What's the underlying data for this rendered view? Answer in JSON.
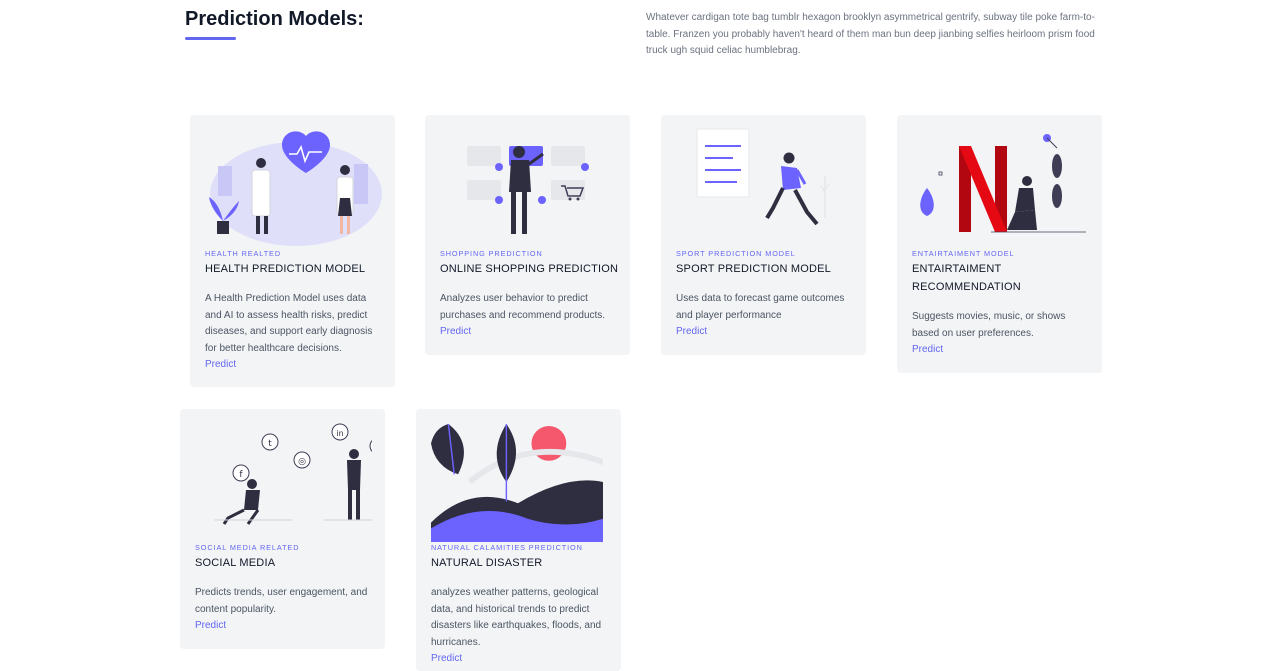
{
  "header": {
    "title": "Prediction Models:",
    "description": "Whatever cardigan tote bag tumblr hexagon brooklyn asymmetrical gentrify, subway tile poke farm-to-table. Franzen you probably haven't heard of them man bun deep jianbing selfies heirloom prism food truck ugh squid celiac humblebrag."
  },
  "cards": [
    {
      "category": "HEALTH REALTED",
      "name": "HEALTH PREDICTION MODEL",
      "description": "A Health Prediction Model uses data and AI to assess health risks, predict diseases, and support early diagnosis for better healthcare decisions.",
      "link": "Predict",
      "illustration": "doctors-heart-illustration"
    },
    {
      "category": "SHOPPING PREDICTION",
      "name": "ONLINE SHOPPING PREDICTION",
      "description": "Analyzes user behavior to predict purchases and recommend products.",
      "link": "Predict",
      "illustration": "online-shopping-illustration"
    },
    {
      "category": "SPORT PREDICTION MODEL",
      "name": "SPORT PREDICTION MODEL",
      "description": "Uses data to forecast game outcomes and player performance",
      "link": "Predict",
      "illustration": "runner-illustration"
    },
    {
      "category": "ENTAIRTAIMENT MODEL",
      "name": "ENTAIRTAIMENT RECOMMENDATION",
      "description": "Suggests movies, music, or shows based on user preferences.",
      "link": "Predict",
      "illustration": "netflix-illustration"
    },
    {
      "category": "SOCIAL MEDIA RELATED",
      "name": "SOCIAL MEDIA",
      "description": "Predicts trends, user engagement, and content popularity.",
      "link": "Predict",
      "illustration": "social-media-illustration"
    },
    {
      "category": "NATURAL CALAMITIES PREDICTION",
      "name": "NATURAL DISASTER",
      "description": "analyzes weather patterns, geological data, and historical trends to predict disasters like earthquakes, floods, and hurricanes.",
      "link": "Predict",
      "illustration": "nature-illustration"
    }
  ],
  "colors": {
    "accent": "#6366f1",
    "card_bg": "#f3f4f6",
    "netflix_red": "#e50914",
    "sun_pink": "#f5576c",
    "dark": "#2f2e41"
  }
}
